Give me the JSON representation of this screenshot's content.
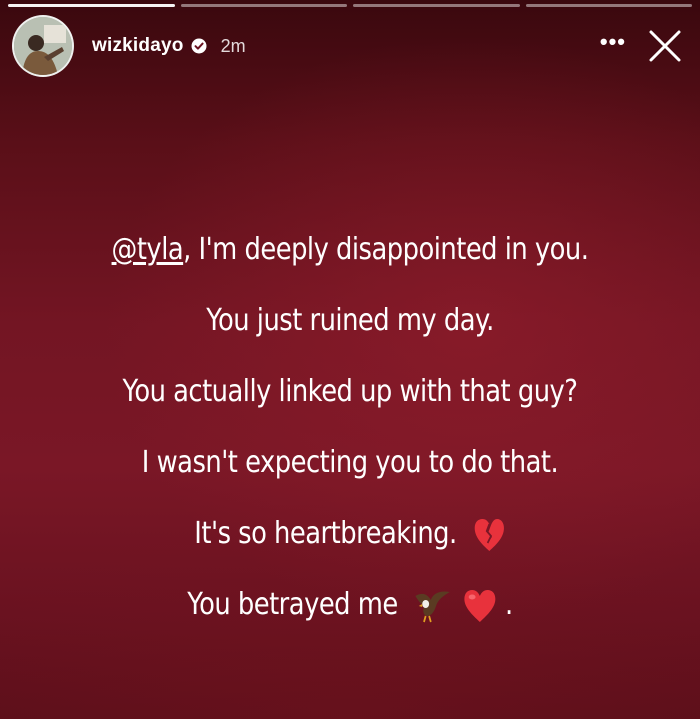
{
  "story": {
    "progress": {
      "segments": 4,
      "completed": 1
    },
    "username": "wizkidayo",
    "verified": true,
    "time": "2m",
    "more_label": "•••",
    "message": {
      "line1_mention": "@tyla",
      "line1_rest": ", I'm deeply disappointed in you.",
      "line2": "You just ruined my day.",
      "line3": "You actually linked up with that guy?",
      "line4": "I wasn't expecting you to do that.",
      "line5": "It's so heartbreaking.",
      "line6_text": "You betrayed me",
      "line6_end": "."
    },
    "emojis": [
      "broken-heart-icon",
      "eagle-icon",
      "red-heart-icon"
    ]
  }
}
